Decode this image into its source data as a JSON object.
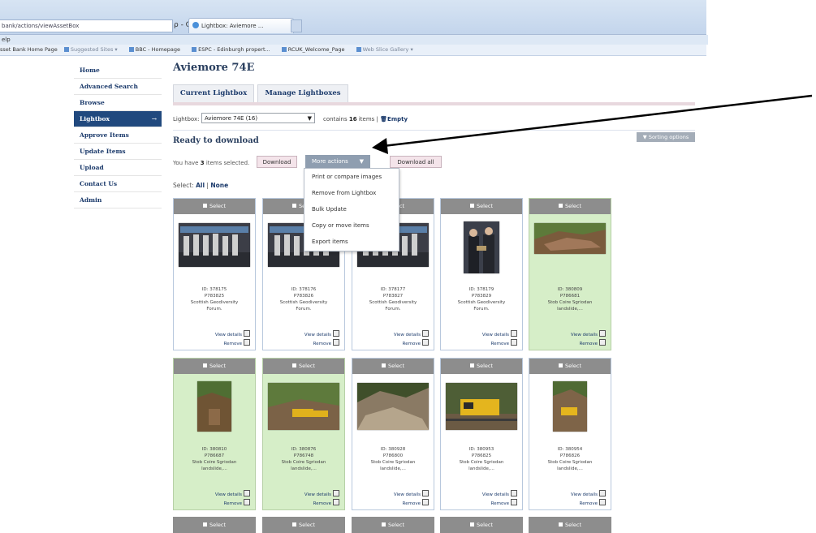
{
  "browser": {
    "url": "bank/actions/viewAssetBox",
    "url_controls": "ρ - C X",
    "tab_title": "Lightbox: Aviemore ...",
    "tab_close": "×",
    "menu": "elp",
    "favorites": [
      "sset Bank Home Page",
      "Suggested Sites ▾",
      "BBC - Homepage",
      "ESPC - Edinburgh propert...",
      "RCUK_Welcome_Page",
      "Web Slice Gallery ▾"
    ]
  },
  "sidebar": {
    "items": [
      {
        "label": "Home"
      },
      {
        "label": "Advanced Search"
      },
      {
        "label": "Browse"
      },
      {
        "label": "Lightbox",
        "arrow": "→"
      },
      {
        "label": "Approve Items"
      },
      {
        "label": "Update Items"
      },
      {
        "label": "Upload"
      },
      {
        "label": "Contact Us"
      },
      {
        "label": "Admin"
      }
    ]
  },
  "page": {
    "title": "Aviemore 74E",
    "tabs": [
      "Current Lightbox",
      "Manage Lightboxes"
    ],
    "lightbox_label": "Lightbox:",
    "lightbox_select": "Aviemore 74E (16)",
    "contains_prefix": "contains",
    "contains_count": "16",
    "contains_suffix": "items |",
    "empty_label": "Empty",
    "sorting_options": "▼ Sorting options",
    "section_title": "Ready to download",
    "selected_prefix": "You have",
    "selected_count": "3",
    "selected_suffix": "items selected.",
    "download": "Download",
    "more_actions": "More actions",
    "download_all": "Download all",
    "select_label": "Select:",
    "select_all": "All",
    "select_sep": "|",
    "select_none": "None"
  },
  "dropdown": {
    "items": [
      "Print or compare images",
      "Remove from Lightbox",
      "Bulk Update",
      "Copy or move items",
      "Export items"
    ]
  },
  "cards": [
    {
      "select": "Select",
      "id": "ID: 378175",
      "code": "P783825",
      "title1": "Scottish Geodiversity",
      "title2": "Forum.",
      "state": "blue",
      "checked": false
    },
    {
      "select": "Select",
      "id": "ID: 378176",
      "code": "P783826",
      "title1": "Scottish Geodiversity",
      "title2": "Forum.",
      "state": "blue",
      "checked": false
    },
    {
      "select": "Select",
      "id": "ID: 378177",
      "code": "P783827",
      "title1": "Scottish Geodiversity",
      "title2": "Forum.",
      "state": "blue",
      "checked": false
    },
    {
      "select": "Select",
      "id": "ID: 378179",
      "code": "P783829",
      "title1": "Scottish Geodiversity",
      "title2": "Forum.",
      "state": "blue",
      "checked": false
    },
    {
      "select": "Select",
      "id": "ID: 380809",
      "code": "P786681",
      "title1": "Stob Coire Sgriodan",
      "title2": "landslide,...",
      "state": "green",
      "checked": true
    },
    {
      "select": "Select",
      "id": "ID: 380810",
      "code": "P786687",
      "title1": "Stob Coire Sgriodan",
      "title2": "landslide,...",
      "state": "green",
      "checked": true
    },
    {
      "select": "Select",
      "id": "ID: 380876",
      "code": "P786748",
      "title1": "Stob Coire Sgriodan",
      "title2": "landslide,...",
      "state": "green",
      "checked": true
    },
    {
      "select": "Select",
      "id": "ID: 380928",
      "code": "P786800",
      "title1": "Stob Coire Sgriodan",
      "title2": "landslide,...",
      "state": "blue",
      "checked": false
    },
    {
      "select": "Select",
      "id": "ID: 380953",
      "code": "P786825",
      "title1": "Stob Coire Sgriodan",
      "title2": "landslide,...",
      "state": "blue",
      "checked": false
    },
    {
      "select": "Select",
      "id": "ID: 380954",
      "code": "P786826",
      "title1": "Stob Coire Sgriodan",
      "title2": "landslide,...",
      "state": "blue",
      "checked": false
    }
  ],
  "card_links": {
    "view": "View details",
    "remove": "Remove"
  },
  "row3_label": "Select",
  "colors": {
    "nav_active": "#21497e",
    "card_blue": "#cfe0f5",
    "card_green": "#d6eec8",
    "more_actions_bg": "#8f9eb0"
  }
}
